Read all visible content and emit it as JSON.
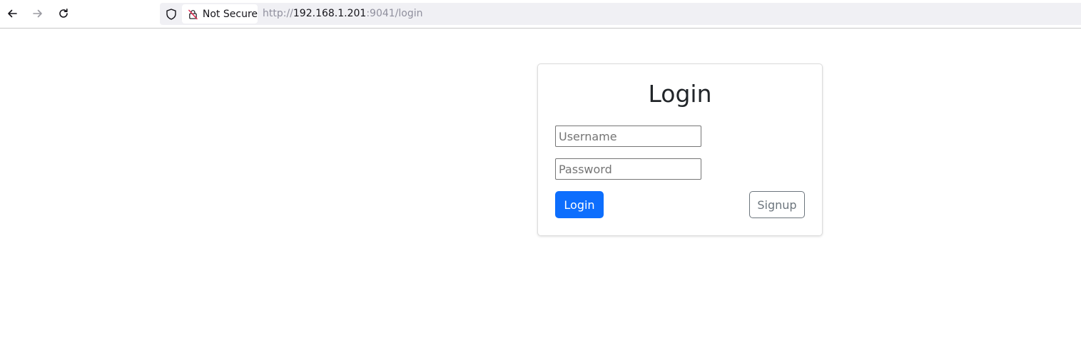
{
  "browser": {
    "back_icon": "arrow-left-icon",
    "forward_icon": "arrow-right-icon",
    "reload_icon": "reload-icon",
    "shield_icon": "shield-icon",
    "security_label": "Not Secure",
    "url": {
      "scheme": "http://",
      "host": "192.168.1.201",
      "rest": ":9041/login"
    }
  },
  "login_form": {
    "title": "Login",
    "username_placeholder": "Username",
    "password_placeholder": "Password",
    "login_label": "Login",
    "signup_label": "Signup"
  },
  "colors": {
    "primary": "#0d6efd",
    "secondary": "#6c757d",
    "insecure_lock": "#e22850"
  }
}
